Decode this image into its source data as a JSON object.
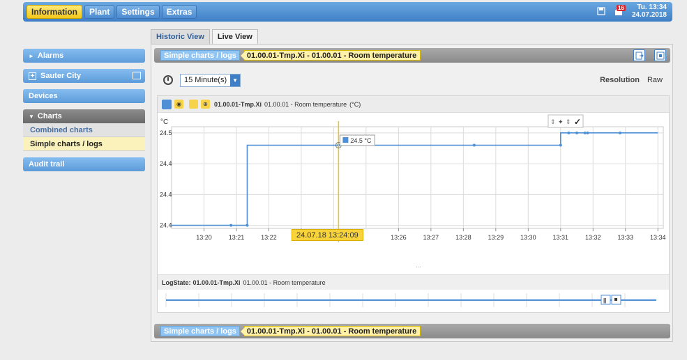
{
  "topbar": {
    "menus": [
      "Information",
      "Plant",
      "Settings",
      "Extras"
    ],
    "alarm_count": "16",
    "day_time": "Tu. 13:34",
    "date": "24.07.2018"
  },
  "sidebar": {
    "alarms": "Alarms",
    "site": "Sauter City",
    "devices": "Devices",
    "charts": "Charts",
    "combined": "Combined charts",
    "simple": "Simple charts / logs",
    "audit": "Audit trail"
  },
  "tabs": [
    "Historic View",
    "Live View"
  ],
  "panel": {
    "breadcrumb_section": "Simple charts / logs",
    "breadcrumb_item": "01.00.01-Tmp.Xi - 01.00.01 - Room temperature",
    "timespan": "15 Minute(s)",
    "resolution_label": "Resolution",
    "resolution_value": "Raw"
  },
  "legend": {
    "id": "01.00.01-Tmp.Xi",
    "desc": "01.00.01 - Room temperature",
    "unit": "(°C)"
  },
  "logstate": {
    "label": "LogState:",
    "id": "01.00.01-Tmp.Xi",
    "desc": "01.00.01 - Room temperature"
  },
  "cursor": {
    "value_label": "24.5 °C",
    "time_label": "24.07.18 13:24:09"
  },
  "colors": {
    "series": "#4f8fd6",
    "cursor": "#f0c419",
    "accent": "#3f7fc6"
  },
  "chart_data": {
    "type": "line",
    "ylabel": "°C",
    "x_ticks": [
      "13:20",
      "13:21",
      "13:22",
      "13",
      "13:26",
      "13:27",
      "13:28",
      "13:29",
      "13:30",
      "13:31",
      "13:32",
      "13:33",
      "13:34"
    ],
    "y_ticks": [
      "24.5",
      "24.4",
      "24.4",
      "24.4"
    ],
    "grid": true,
    "series": [
      {
        "step": true,
        "points": [
          {
            "x": "13:19:00",
            "y": 24.35
          },
          {
            "x": "13:20:50",
            "y": 24.35
          },
          {
            "x": "13:21:20",
            "y": 24.35
          },
          {
            "x": "13:21:20",
            "y": 24.48
          },
          {
            "x": "13:24:09",
            "y": 24.48
          },
          {
            "x": "13:28:20",
            "y": 24.48
          },
          {
            "x": "13:31:00",
            "y": 24.48
          },
          {
            "x": "13:31:00",
            "y": 24.5
          },
          {
            "x": "13:31:15",
            "y": 24.5
          },
          {
            "x": "13:31:30",
            "y": 24.5
          },
          {
            "x": "13:31:45",
            "y": 24.5
          },
          {
            "x": "13:31:50",
            "y": 24.5
          },
          {
            "x": "13:32:50",
            "y": 24.5
          },
          {
            "x": "13:34:00",
            "y": 24.5
          }
        ]
      }
    ]
  }
}
